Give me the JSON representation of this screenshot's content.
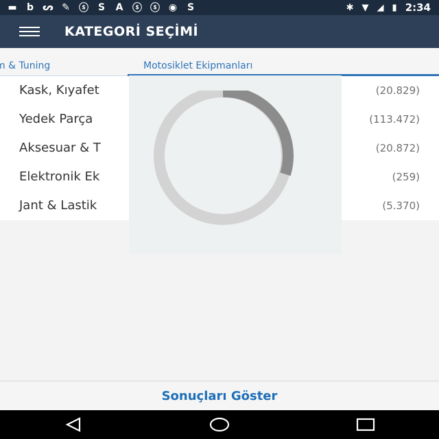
{
  "status_bar": {
    "icons": [
      "message-icon",
      "b-icon",
      "bird-icon",
      "wrench-icon",
      "sf-icon",
      "s-icon",
      "a-icon",
      "sf-icon",
      "sf-icon",
      "sports-icon",
      "s-icon"
    ],
    "icon_glyphs": [
      "▬",
      "b",
      "ᔕ",
      "✎",
      "ⓢ",
      "S",
      "A",
      "ⓢ",
      "ⓢ",
      "◉",
      "S"
    ],
    "bluetooth": "✱",
    "wifi": "▼",
    "signal": "◢",
    "battery": "▮",
    "time": "2:34"
  },
  "app_bar": {
    "title": "KATEGORİ SEÇİMİ"
  },
  "tabs": [
    {
      "label": "m & Tuning"
    },
    {
      "label": "Motosiklet Ekipmanları"
    }
  ],
  "categories": [
    {
      "name": "Kask, Kıyafet",
      "count": "(20.829)"
    },
    {
      "name": "Yedek Parça",
      "count": "(113.472)"
    },
    {
      "name": "Aksesuar & T",
      "count": "(20.872)"
    },
    {
      "name": "Elektronik Ek",
      "count": "(259)"
    },
    {
      "name": "Jant & Lastik",
      "count": "(5.370)"
    }
  ],
  "bottom_bar": {
    "button_label": "Sonuçları Göster"
  },
  "colors": {
    "status_bar": "#1c2b3d",
    "app_bar": "#2e4058",
    "accent": "#2f74b8",
    "button_text": "#1f6fb8"
  }
}
